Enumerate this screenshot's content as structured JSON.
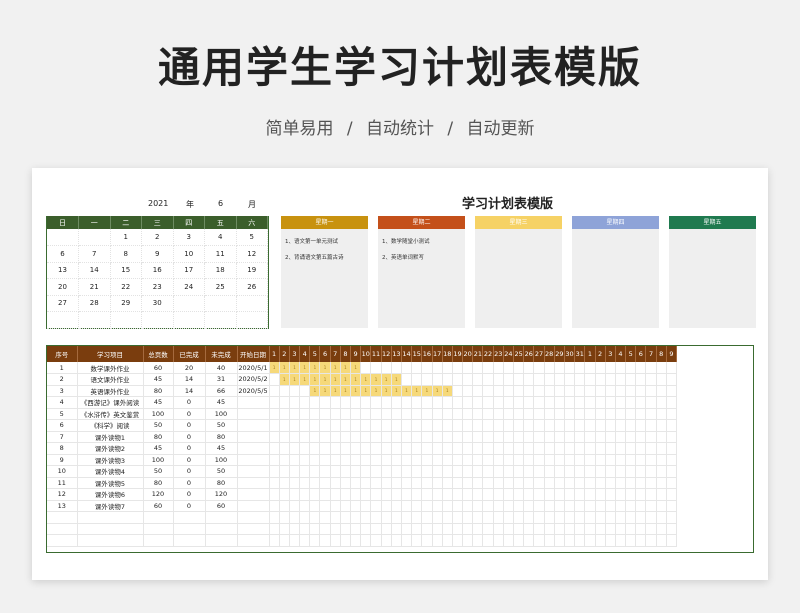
{
  "hero": {
    "title": "通用学生学习计划表模版",
    "subtitle": "简单易用   /   自动统计   /   自动更新"
  },
  "sheet": {
    "plan_title": "学习计划表模版",
    "year": "2021",
    "year_unit": "年",
    "month": "6",
    "month_unit": "月"
  },
  "calendar": {
    "headers": [
      "日",
      "一",
      "二",
      "三",
      "四",
      "五",
      "六"
    ],
    "weeks": [
      [
        "",
        "",
        "1",
        "2",
        "3",
        "4",
        "5"
      ],
      [
        "6",
        "7",
        "8",
        "9",
        "10",
        "11",
        "12"
      ],
      [
        "13",
        "14",
        "15",
        "16",
        "17",
        "18",
        "19"
      ],
      [
        "20",
        "21",
        "22",
        "23",
        "24",
        "25",
        "26"
      ],
      [
        "27",
        "28",
        "29",
        "30",
        "",
        "",
        ""
      ],
      [
        "",
        "",
        "",
        "",
        "",
        "",
        ""
      ]
    ]
  },
  "weekdays": [
    {
      "label": "星期一",
      "color": "#c8920f",
      "items": [
        "1、语文第一单元测试",
        "2、背诵语文第五篇古诗"
      ]
    },
    {
      "label": "星期二",
      "color": "#c4501a",
      "items": [
        "1、数学随堂小测试",
        "2、英语单词默写"
      ]
    },
    {
      "label": "星期三",
      "color": "#f6d265",
      "items": []
    },
    {
      "label": "星期四",
      "color": "#8ea3d8",
      "items": []
    },
    {
      "label": "星期五",
      "color": "#1f7a4f",
      "items": []
    }
  ],
  "tasks": {
    "headers": [
      "序号",
      "学习项目",
      "总页数",
      "已完成",
      "未完成",
      "开始日期"
    ],
    "day_headers": [
      "1",
      "2",
      "3",
      "4",
      "5",
      "6",
      "7",
      "8",
      "9",
      "10",
      "11",
      "12",
      "13",
      "14",
      "15",
      "16",
      "17",
      "18",
      "19",
      "20",
      "21",
      "22",
      "23",
      "24",
      "25",
      "26",
      "27",
      "28",
      "29",
      "30",
      "31",
      "1",
      "2",
      "3",
      "4",
      "5",
      "6",
      "7",
      "8",
      "9"
    ],
    "rows": [
      {
        "no": "1",
        "name": "数学课外作业",
        "total": "60",
        "done": "20",
        "left": "40",
        "start": "2020/5/1",
        "bar_start": 0,
        "bar_len": 9
      },
      {
        "no": "2",
        "name": "语文课外作业",
        "total": "45",
        "done": "14",
        "left": "31",
        "start": "2020/5/2",
        "bar_start": 1,
        "bar_len": 12
      },
      {
        "no": "3",
        "name": "英语课外作业",
        "total": "80",
        "done": "14",
        "left": "66",
        "start": "2020/5/5",
        "bar_start": 4,
        "bar_len": 14
      },
      {
        "no": "4",
        "name": "《西游记》课外阅读",
        "total": "45",
        "done": "0",
        "left": "45",
        "start": ""
      },
      {
        "no": "5",
        "name": "《水浒传》英文鉴赏",
        "total": "100",
        "done": "0",
        "left": "100",
        "start": ""
      },
      {
        "no": "6",
        "name": "《科学》阅读",
        "total": "50",
        "done": "0",
        "left": "50",
        "start": ""
      },
      {
        "no": "7",
        "name": "课外读物1",
        "total": "80",
        "done": "0",
        "left": "80",
        "start": ""
      },
      {
        "no": "8",
        "name": "课外读物2",
        "total": "45",
        "done": "0",
        "left": "45",
        "start": ""
      },
      {
        "no": "9",
        "name": "课外读物3",
        "total": "100",
        "done": "0",
        "left": "100",
        "start": ""
      },
      {
        "no": "10",
        "name": "课外读物4",
        "total": "50",
        "done": "0",
        "left": "50",
        "start": ""
      },
      {
        "no": "11",
        "name": "课外读物5",
        "total": "80",
        "done": "0",
        "left": "80",
        "start": ""
      },
      {
        "no": "12",
        "name": "课外读物6",
        "total": "120",
        "done": "0",
        "left": "120",
        "start": ""
      },
      {
        "no": "13",
        "name": "课外读物7",
        "total": "60",
        "done": "0",
        "left": "60",
        "start": ""
      },
      {
        "no": "",
        "name": "",
        "total": "",
        "done": "",
        "left": "",
        "start": ""
      },
      {
        "no": "",
        "name": "",
        "total": "",
        "done": "",
        "left": "",
        "start": ""
      },
      {
        "no": "",
        "name": "",
        "total": "",
        "done": "",
        "left": "",
        "start": ""
      }
    ],
    "bar_mark": "1"
  }
}
